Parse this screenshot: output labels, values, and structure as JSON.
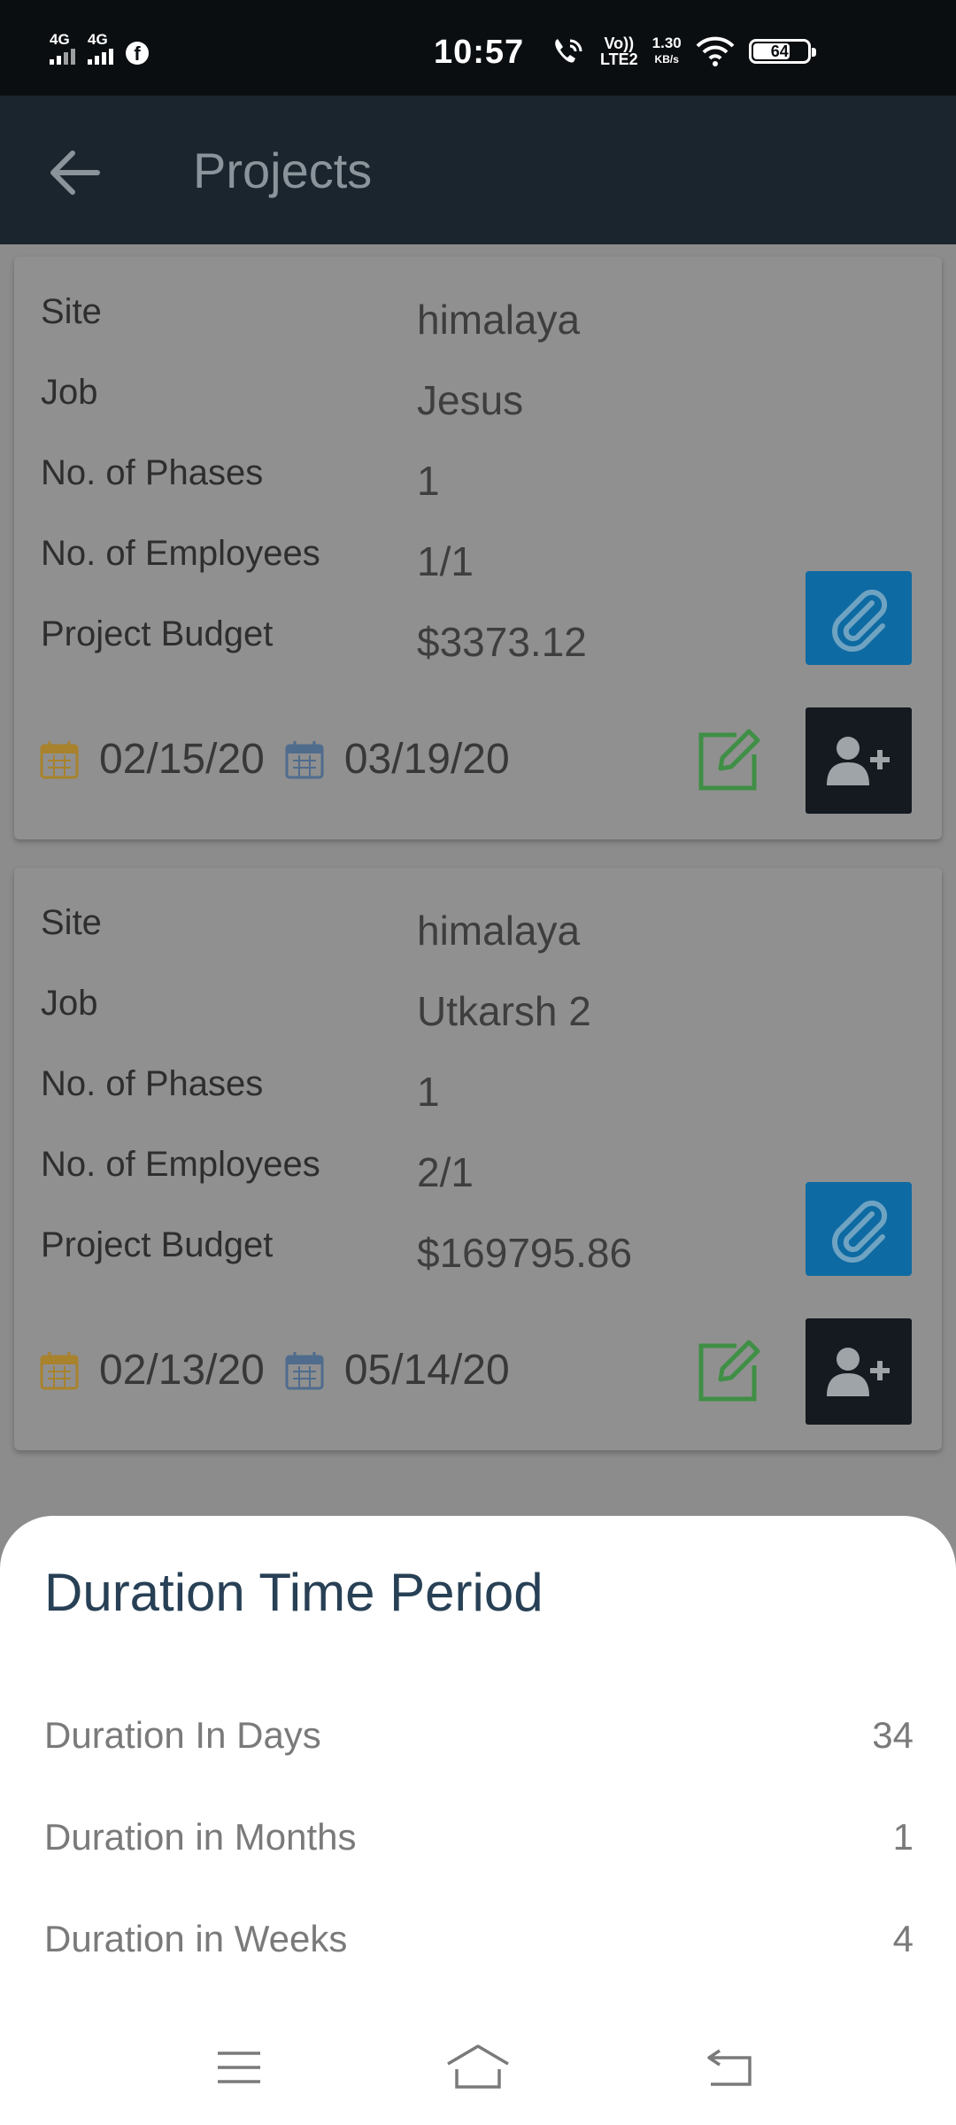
{
  "status_bar": {
    "sim1": "4G",
    "sim2": "4G",
    "time": "10:57",
    "volte_top": "Vo))",
    "volte_bottom": "LTE2",
    "speed_value": "1.30",
    "speed_unit": "KB/s",
    "battery": "64"
  },
  "app_bar": {
    "title": "Projects"
  },
  "projects": [
    {
      "fields": [
        {
          "label": "Site",
          "value": "himalaya"
        },
        {
          "label": "Job",
          "value": "Jesus"
        },
        {
          "label": "No. of Phases",
          "value": "1"
        },
        {
          "label": "No. of Employees",
          "value": "1/1"
        },
        {
          "label": "Project Budget",
          "value": "$3373.12"
        }
      ],
      "start_date": "02/15/20",
      "end_date": "03/19/20"
    },
    {
      "fields": [
        {
          "label": "Site",
          "value": "himalaya"
        },
        {
          "label": "Job",
          "value": "Utkarsh 2"
        },
        {
          "label": "No. of Phases",
          "value": "1"
        },
        {
          "label": "No. of Employees",
          "value": "2/1"
        },
        {
          "label": "Project Budget",
          "value": "$169795.86"
        }
      ],
      "start_date": "02/13/20",
      "end_date": "05/14/20"
    }
  ],
  "sheet": {
    "title": "Duration Time Period",
    "rows": [
      {
        "label": "Duration In Days",
        "value": "34"
      },
      {
        "label": "Duration in Months",
        "value": "1"
      },
      {
        "label": "Duration in Weeks",
        "value": "4"
      }
    ]
  },
  "colors": {
    "app_bar": "#1b252e",
    "attach_button": "#0e6aa2",
    "add_user_button": "#141a1f",
    "edit_icon": "#3f8f46",
    "start_calendar": "#a8822c",
    "end_calendar": "#4f6c8d",
    "sheet_title": "#274055"
  },
  "icons": [
    "back-arrow-icon",
    "paperclip-icon",
    "calendar-icon",
    "edit-icon",
    "add-user-icon",
    "menu-icon",
    "home-icon",
    "back-icon"
  ]
}
